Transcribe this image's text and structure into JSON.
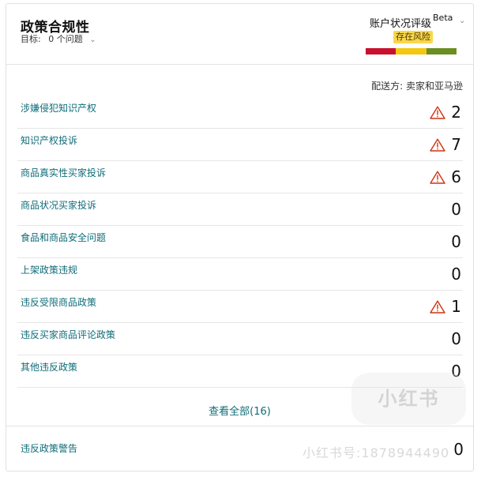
{
  "header": {
    "title": "政策合规性",
    "target_label": "目标:",
    "target_value": "0 个问题"
  },
  "account_health": {
    "title": "账户状况评级",
    "beta": "Beta",
    "status": "存在风险",
    "meter_colors": [
      "#c8102e",
      "#f2c811",
      "#6b8e23"
    ]
  },
  "ship_from": "配送方: 卖家和亚马逊",
  "violations": [
    {
      "label": "涉嫌侵犯知识产权",
      "count": "2",
      "warning": true
    },
    {
      "label": "知识产权投诉",
      "count": "7",
      "warning": true
    },
    {
      "label": "商品真实性买家投诉",
      "count": "6",
      "warning": true
    },
    {
      "label": "商品状况买家投诉",
      "count": "0",
      "warning": false
    },
    {
      "label": "食品和商品安全问题",
      "count": "0",
      "warning": false
    },
    {
      "label": "上架政策违规",
      "count": "0",
      "warning": false
    },
    {
      "label": "违反受限商品政策",
      "count": "1",
      "warning": true
    },
    {
      "label": "违反买家商品评论政策",
      "count": "0",
      "warning": false
    },
    {
      "label": "其他违反政策",
      "count": "0",
      "warning": false
    }
  ],
  "view_all": "查看全部(16)",
  "policy_warnings": {
    "label": "违反政策警告",
    "count": "0"
  },
  "watermark": {
    "logo": "小红书",
    "id": "小红书号:1878944490"
  },
  "colors": {
    "link": "#0f6c78",
    "warning": "#d13212",
    "risk_badge": "#f9d74c"
  }
}
